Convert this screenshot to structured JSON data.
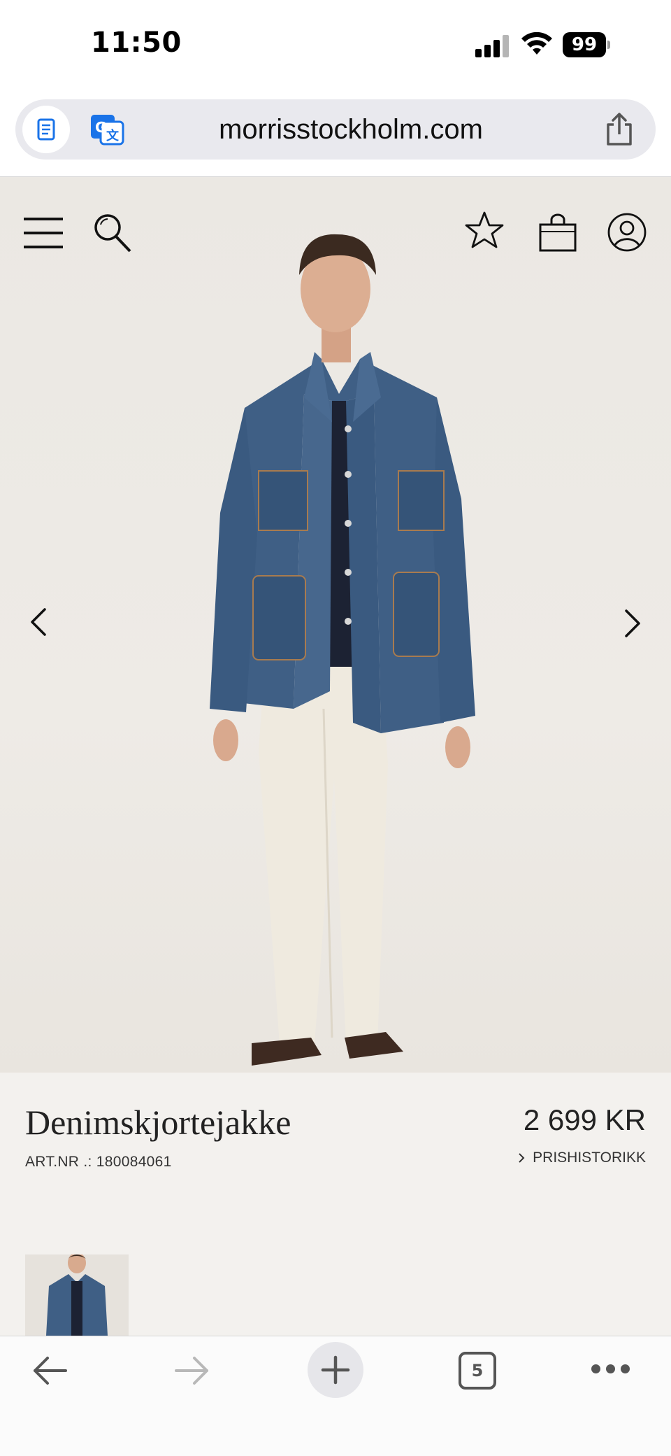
{
  "status_bar": {
    "time": "11:50",
    "battery": "99"
  },
  "browser": {
    "url": "morrisstockholm.com",
    "open_tabs": "5"
  },
  "site_header": {
    "icons": [
      "hamburger-menu-icon",
      "search-icon",
      "star-icon",
      "shopping-bag-icon",
      "account-icon"
    ]
  },
  "gallery": {
    "prev_icon": "chevron-left-icon",
    "next_icon": "chevron-right-icon"
  },
  "product": {
    "name": "Denimskjortejakke",
    "price": "2 699 KR",
    "art_nr": "ART.NR .: 180084061",
    "price_history": "PRISHISTORIKK"
  },
  "colors": {
    "hero_bg": "#ece9e4",
    "info_bg": "#f3f1ee",
    "denim": "#3f5f85",
    "text": "#222222"
  }
}
